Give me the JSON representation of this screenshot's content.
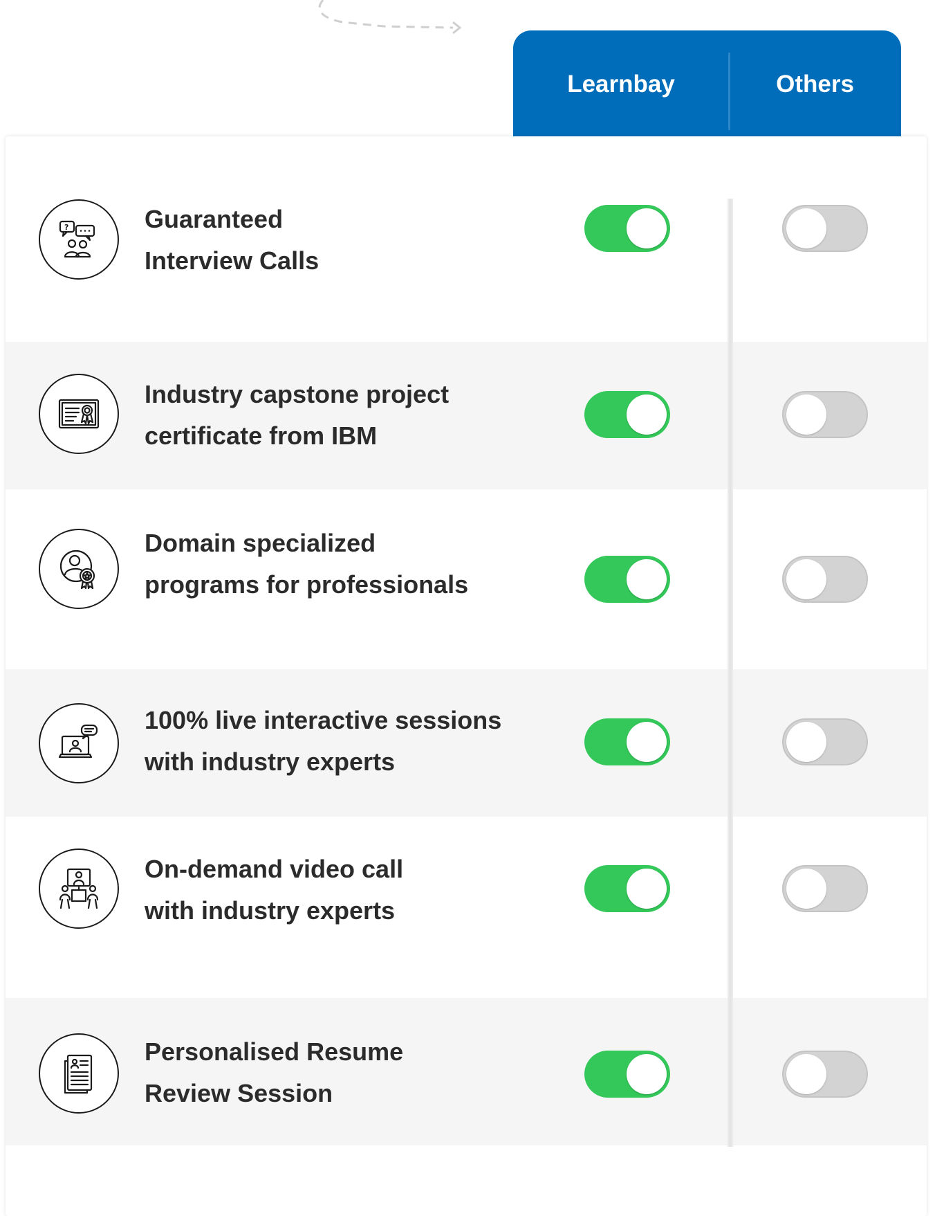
{
  "header": {
    "learnbay_label": "Learnbay",
    "others_label": "Others",
    "bg_color": "#006dba"
  },
  "colors": {
    "toggle_on": "#34c759",
    "toggle_off": "#d3d3d3",
    "row_shade": "#f5f5f5"
  },
  "features": [
    {
      "line1": "Guaranteed",
      "line2": "Interview Calls",
      "icon": "interview-chat-icon",
      "learnbay": true,
      "others": false
    },
    {
      "line1": "Industry capstone project",
      "line2": "certificate from IBM",
      "icon": "certificate-icon",
      "learnbay": true,
      "others": false
    },
    {
      "line1": "Domain specialized",
      "line2": "programs for professionals",
      "icon": "professional-badge-icon",
      "learnbay": true,
      "others": false
    },
    {
      "line1": "100% live interactive sessions",
      "line2": "with industry experts",
      "icon": "live-session-laptop-icon",
      "learnbay": true,
      "others": false
    },
    {
      "line1": "On-demand video call",
      "line2": "with industry experts",
      "icon": "video-call-meeting-icon",
      "learnbay": true,
      "others": false
    },
    {
      "line1": "Personalised Resume",
      "line2": "Review Session",
      "icon": "resume-document-icon",
      "learnbay": true,
      "others": false
    }
  ]
}
